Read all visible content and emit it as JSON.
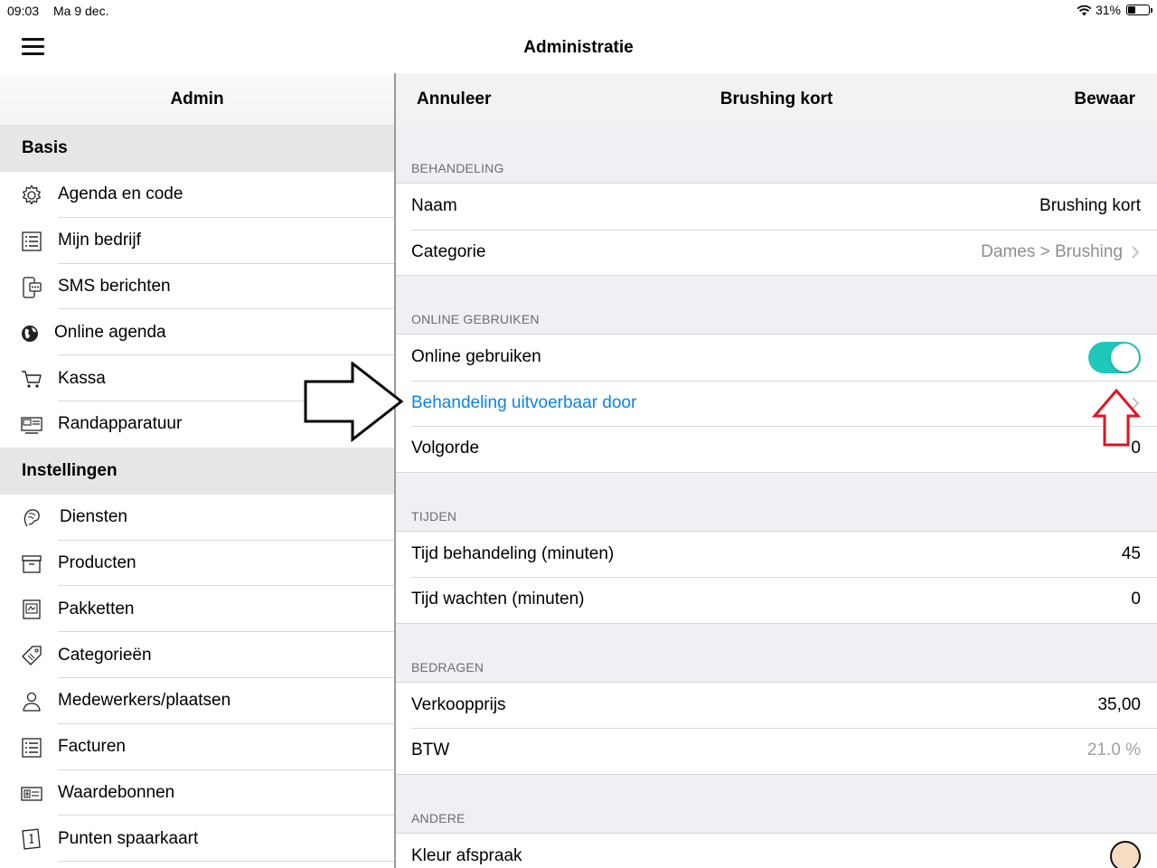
{
  "status_bar": {
    "time": "09:03",
    "date": "Ma 9 dec.",
    "battery": "31%",
    "battery_level": 0.31,
    "icons": [
      "wifi-icon",
      "battery-icon"
    ]
  },
  "app": {
    "title": "Administratie",
    "menu_icon": "hamburger-icon"
  },
  "sidebar": {
    "title": "Admin",
    "sections": [
      {
        "title": "Basis",
        "items": [
          {
            "label": "Agenda en code",
            "icon": "gear-icon"
          },
          {
            "label": "Mijn bedrijf",
            "icon": "list-icon"
          },
          {
            "label": "SMS berichten",
            "icon": "phone-message-icon"
          },
          {
            "label": "Online agenda",
            "icon": "globe-icon"
          },
          {
            "label": "Kassa",
            "icon": "cart-icon"
          },
          {
            "label": "Randapparatuur",
            "icon": "devices-icon"
          }
        ]
      },
      {
        "title": "Instellingen",
        "items": [
          {
            "label": "Diensten",
            "icon": "hair-icon"
          },
          {
            "label": "Producten",
            "icon": "box-icon"
          },
          {
            "label": "Pakketten",
            "icon": "package-icon"
          },
          {
            "label": "Categorieën",
            "icon": "tag-icon"
          },
          {
            "label": "Medewerkers/plaatsen",
            "icon": "person-icon"
          },
          {
            "label": "Facturen",
            "icon": "list-icon"
          },
          {
            "label": "Waardebonnen",
            "icon": "voucher-icon"
          },
          {
            "label": "Punten spaarkaart",
            "icon": "card-icon"
          }
        ]
      }
    ]
  },
  "detail": {
    "cancel_label": "Annuleer",
    "title": "Brushing kort",
    "save_label": "Bewaar",
    "groups": [
      {
        "header": "BEHANDELING",
        "rows": [
          {
            "label": "Naam",
            "value": "Brushing kort"
          },
          {
            "label": "Categorie",
            "value": "Dames > Brushing"
          }
        ]
      },
      {
        "header": "ONLINE GEBRUIKEN",
        "rows": [
          {
            "label": "Online gebruiken",
            "toggle_on": true
          },
          {
            "label": "Behandeling uitvoerbaar door"
          },
          {
            "label": "Volgorde",
            "value": "0"
          }
        ]
      },
      {
        "header": "TIJDEN",
        "rows": [
          {
            "label": "Tijd behandeling (minuten)",
            "value": "45"
          },
          {
            "label": "Tijd wachten (minuten)",
            "value": "0"
          }
        ]
      },
      {
        "header": "BEDRAGEN",
        "rows": [
          {
            "label": "Verkoopprijs",
            "value": "35,00"
          },
          {
            "label": "BTW",
            "value": "21.0 %"
          }
        ]
      },
      {
        "header": "ANDERE",
        "rows": [
          {
            "label": "Kleur afspraak",
            "color": "#f7dcc4"
          }
        ]
      }
    ]
  },
  "colors": {
    "accent_link": "#0a84e6",
    "toggle_on": "#1ec9b9",
    "section_bg": "#e6e6e6",
    "annotation_red": "#e0141e"
  }
}
